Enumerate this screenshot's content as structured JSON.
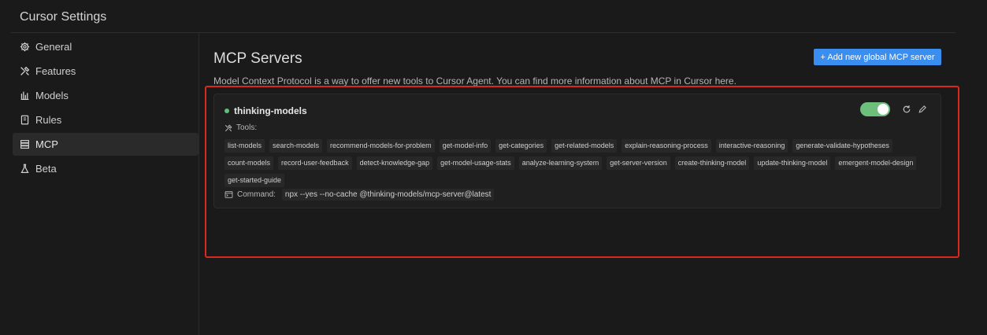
{
  "app": {
    "title": "Cursor Settings"
  },
  "sidebar": {
    "items": [
      {
        "label": "General",
        "icon": "gear-icon"
      },
      {
        "label": "Features",
        "icon": "tools-icon"
      },
      {
        "label": "Models",
        "icon": "models-icon"
      },
      {
        "label": "Rules",
        "icon": "rules-icon"
      },
      {
        "label": "MCP",
        "icon": "mcp-icon",
        "active": true
      },
      {
        "label": "Beta",
        "icon": "flask-icon"
      }
    ]
  },
  "main": {
    "title": "MCP Servers",
    "add_button": "+ Add new global MCP server",
    "description": "Model Context Protocol is a way to offer new tools to Cursor Agent. You can find more information about MCP in Cursor ",
    "description_link": "here."
  },
  "server": {
    "name": "thinking-models",
    "status_color": "#5fbf7a",
    "enabled": true,
    "tools_label": "Tools:",
    "tools": [
      "list-models",
      "search-models",
      "recommend-models-for-problem",
      "get-model-info",
      "get-categories",
      "get-related-models",
      "explain-reasoning-process",
      "interactive-reasoning",
      "generate-validate-hypotheses",
      "count-models",
      "record-user-feedback",
      "detect-knowledge-gap",
      "get-model-usage-stats",
      "analyze-learning-system",
      "get-server-version",
      "create-thinking-model",
      "update-thinking-model",
      "emergent-model-design",
      "get-started-guide"
    ],
    "command_label": "Command:",
    "command": "npx --yes --no-cache @thinking-models/mcp-server@latest"
  },
  "colors": {
    "accent": "#3a8ef0",
    "toggle_on": "#6cc07c",
    "highlight": "#d9291c"
  }
}
